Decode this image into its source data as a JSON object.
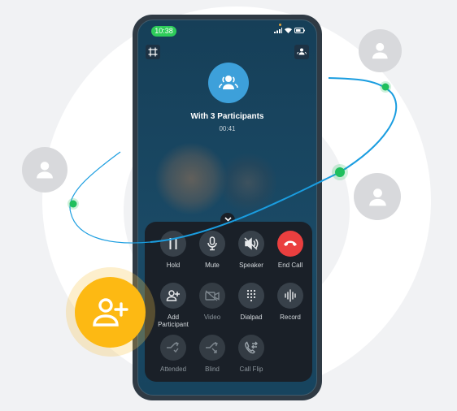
{
  "status_bar": {
    "time": "10:38",
    "icons": [
      "signal-icon",
      "wifi-icon",
      "battery-icon"
    ]
  },
  "top_bar": {
    "left_icon": "screen-capture-icon",
    "right_icon": "participants-icon"
  },
  "call": {
    "avatar_icon": "group-icon",
    "title": "With 3 Participants",
    "duration": "00:41"
  },
  "panel": {
    "collapse_icon": "chevron-down-icon",
    "controls": [
      {
        "label": "Hold",
        "icon": "pause-icon",
        "enabled": true
      },
      {
        "label": "Mute",
        "icon": "microphone-icon",
        "enabled": true
      },
      {
        "label": "Speaker",
        "icon": "speaker-muted-icon",
        "enabled": true
      },
      {
        "label": "End Call",
        "icon": "end-call-icon",
        "enabled": true
      },
      {
        "label": "Add Participant",
        "icon": "add-user-icon",
        "enabled": true
      },
      {
        "label": "Video",
        "icon": "video-off-icon",
        "enabled": false
      },
      {
        "label": "Dialpad",
        "icon": "dialpad-icon",
        "enabled": true
      },
      {
        "label": "Record",
        "icon": "record-waveform-icon",
        "enabled": true
      },
      {
        "label": "Attended",
        "icon": "attended-transfer-icon",
        "enabled": false
      },
      {
        "label": "Blind",
        "icon": "blind-transfer-icon",
        "enabled": false
      },
      {
        "label": "Call Flip",
        "icon": "call-flip-icon",
        "enabled": true
      }
    ]
  },
  "decor": {
    "floating_avatars": [
      "user-icon",
      "user-icon",
      "user-icon"
    ],
    "feature_badge_icon": "add-user-icon"
  },
  "colors": {
    "accent_blue": "#3da0da",
    "end_call_red": "#ea3f3f",
    "status_green": "#2ecc5a",
    "node_green": "#1fbf5c",
    "feature_yellow": "#fdb913",
    "orbit_blue": "#1a9de0"
  }
}
